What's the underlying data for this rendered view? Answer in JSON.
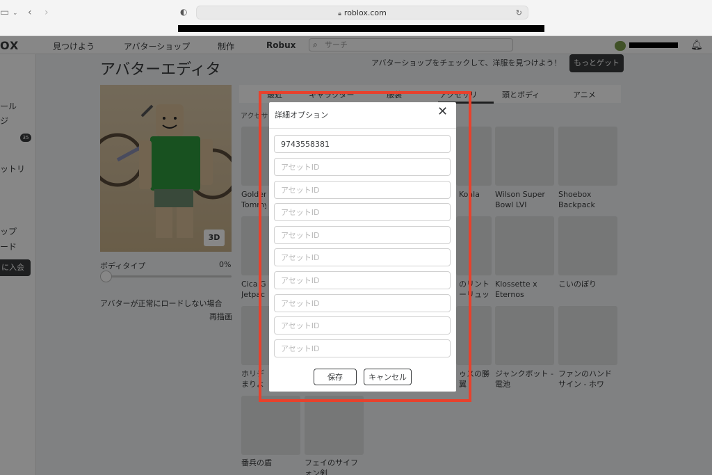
{
  "browser": {
    "url": "roblox.com"
  },
  "header": {
    "logo": "OX",
    "nav": [
      "見つけよう",
      "アバターショップ",
      "制作",
      "Robux"
    ],
    "search_placeholder": "サーチ"
  },
  "sidebar": {
    "items": [
      "ール",
      "ジ",
      "",
      "ットリ",
      "",
      "ップ",
      "ード"
    ],
    "badge": "35",
    "join_button": "に入会"
  },
  "main": {
    "title": "アバターエディタ",
    "promo_text": "アバターショップをチェックして、洋服を見つけよう！",
    "more_button": "もっとゲット",
    "btn_3d": "3D",
    "body_type_label": "ボディタイプ",
    "body_type_value": "0%",
    "body_type_level": 0,
    "reload_message": "アバターが正常にロードしない場合",
    "redraw_link": "再描画",
    "tabs": [
      "最近",
      "キャラクター",
      "服装",
      "アクセサリ",
      "頭とボディ",
      "アニメ"
    ],
    "breadcrumb": "アクセサ",
    "items": [
      {
        "name": "Golden Tommy"
      },
      {
        "name": ""
      },
      {
        "name": ""
      },
      {
        "name": "Koala"
      },
      {
        "name": "Wilson Super Bowl LVI"
      },
      {
        "name": "Shoebox Backpack"
      },
      {
        "name": "Cica G Jetpac"
      },
      {
        "name": ""
      },
      {
        "name": ""
      },
      {
        "name": "のリント ーリュッ"
      },
      {
        "name": "Klossette x Eternos"
      },
      {
        "name": "こいのぼり"
      },
      {
        "name": "ホリデ まりよ"
      },
      {
        "name": ""
      },
      {
        "name": ""
      },
      {
        "name": "ゥスの勝 翼"
      },
      {
        "name": "ジャンクボット - 電池"
      },
      {
        "name": "ファンのハンド サイン - ホワ"
      },
      {
        "name": "番兵の盾"
      },
      {
        "name": "フェイのサイフ ォン剣"
      }
    ]
  },
  "modal": {
    "title": "詳細オプション",
    "inputs": [
      {
        "value": "9743558381",
        "placeholder": "アセットID"
      },
      {
        "value": "",
        "placeholder": "アセットID"
      },
      {
        "value": "",
        "placeholder": "アセットID"
      },
      {
        "value": "",
        "placeholder": "アセットID"
      },
      {
        "value": "",
        "placeholder": "アセットID"
      },
      {
        "value": "",
        "placeholder": "アセットID"
      },
      {
        "value": "",
        "placeholder": "アセットID"
      },
      {
        "value": "",
        "placeholder": "アセットID"
      },
      {
        "value": "",
        "placeholder": "アセットID"
      },
      {
        "value": "",
        "placeholder": "アセットID"
      }
    ],
    "save_label": "保存",
    "cancel_label": "キャンセル"
  },
  "colors": {
    "highlight": "#e8412c",
    "dark": "#393b3d"
  },
  "icons": {
    "close": "close-icon",
    "search": "search-icon",
    "bell": "bell-icon",
    "lock": "lock-icon",
    "reload": "reload-icon"
  }
}
